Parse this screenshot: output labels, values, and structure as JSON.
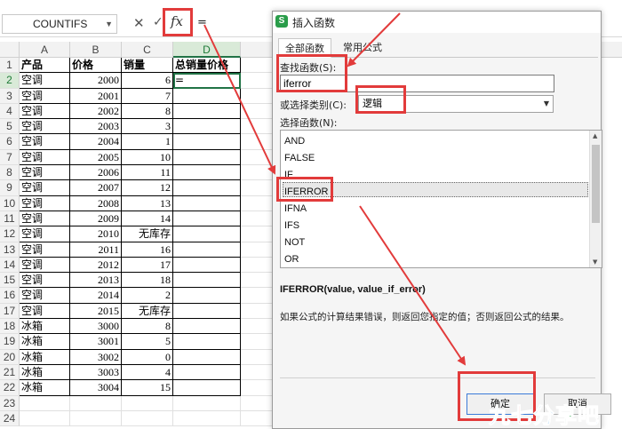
{
  "formula_bar": {
    "name_box": "COUNTIFS",
    "cancel_glyph": "✕",
    "confirm_glyph": "✓",
    "fx_label": "fx",
    "value": "="
  },
  "sheet": {
    "columns": [
      "A",
      "B",
      "C",
      "D"
    ],
    "active_column": "D",
    "rows": [
      {
        "n": "1",
        "a": "产品",
        "b": "价格",
        "c": "销量",
        "d": "总销量价格"
      },
      {
        "n": "2",
        "a": "空调",
        "b": "2000",
        "c": "6",
        "d": "="
      },
      {
        "n": "3",
        "a": "空调",
        "b": "2001",
        "c": "7",
        "d": ""
      },
      {
        "n": "4",
        "a": "空调",
        "b": "2002",
        "c": "8",
        "d": ""
      },
      {
        "n": "5",
        "a": "空调",
        "b": "2003",
        "c": "3",
        "d": ""
      },
      {
        "n": "6",
        "a": "空调",
        "b": "2004",
        "c": "1",
        "d": ""
      },
      {
        "n": "7",
        "a": "空调",
        "b": "2005",
        "c": "10",
        "d": ""
      },
      {
        "n": "8",
        "a": "空调",
        "b": "2006",
        "c": "11",
        "d": ""
      },
      {
        "n": "9",
        "a": "空调",
        "b": "2007",
        "c": "12",
        "d": ""
      },
      {
        "n": "10",
        "a": "空调",
        "b": "2008",
        "c": "13",
        "d": ""
      },
      {
        "n": "11",
        "a": "空调",
        "b": "2009",
        "c": "14",
        "d": ""
      },
      {
        "n": "12",
        "a": "空调",
        "b": "2010",
        "c": "无库存",
        "d": ""
      },
      {
        "n": "13",
        "a": "空调",
        "b": "2011",
        "c": "16",
        "d": ""
      },
      {
        "n": "14",
        "a": "空调",
        "b": "2012",
        "c": "17",
        "d": ""
      },
      {
        "n": "15",
        "a": "空调",
        "b": "2013",
        "c": "18",
        "d": ""
      },
      {
        "n": "16",
        "a": "空调",
        "b": "2014",
        "c": "2",
        "d": ""
      },
      {
        "n": "17",
        "a": "空调",
        "b": "2015",
        "c": "无库存",
        "d": ""
      },
      {
        "n": "18",
        "a": "冰箱",
        "b": "3000",
        "c": "8",
        "d": ""
      },
      {
        "n": "19",
        "a": "冰箱",
        "b": "3001",
        "c": "5",
        "d": ""
      },
      {
        "n": "20",
        "a": "冰箱",
        "b": "3002",
        "c": "0",
        "d": ""
      },
      {
        "n": "21",
        "a": "冰箱",
        "b": "3003",
        "c": "4",
        "d": ""
      },
      {
        "n": "22",
        "a": "冰箱",
        "b": "3004",
        "c": "15",
        "d": ""
      },
      {
        "n": "23",
        "a": "",
        "b": "",
        "c": "",
        "d": ""
      },
      {
        "n": "24",
        "a": "",
        "b": "",
        "c": "",
        "d": ""
      }
    ]
  },
  "dialog": {
    "logo": "S",
    "title": "插入函数",
    "tabs": [
      "全部函数",
      "常用公式"
    ],
    "search_label": "查找函数(S):",
    "search_value": "iferror",
    "category_label": "或选择类别(C):",
    "category_value": "逻辑",
    "select_label": "选择函数(N):",
    "functions": [
      "AND",
      "FALSE",
      "IF",
      "IFERROR",
      "IFNA",
      "IFS",
      "NOT",
      "OR"
    ],
    "selected_function": "IFERROR",
    "signature": "IFERROR(value, value_if_error)",
    "description": "如果公式的计算结果错误，则返回您指定的值；否则返回公式的结果。",
    "ok_label": "确定",
    "cancel_label": "取消"
  },
  "watermark": {
    "chars": [
      "九",
      "七",
      "分",
      "享",
      "吧"
    ],
    "colors": [
      "#1a8fe3",
      "#e6332a",
      "#1a8fe3",
      "#2aa84a",
      "#1a8fe3"
    ]
  },
  "annotation_color": "#e23b3b"
}
